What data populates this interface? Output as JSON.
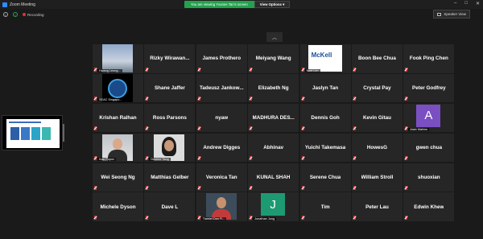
{
  "window": {
    "title": "Zoom Meeting",
    "controls": [
      "–",
      "□",
      "✕"
    ]
  },
  "banner": {
    "text": "You are viewing Yvonne Tan's screen",
    "view_options": "View Options ▾"
  },
  "infobar": {
    "recording": "Recording",
    "speaker_view": "Speaker View"
  },
  "colors": {
    "mute": "#e03b3b",
    "banner_green": "#23a24d",
    "tile_bg": "#262626"
  },
  "tiles": [
    {
      "name": "",
      "label": "Hwang Leong...",
      "video": "sky"
    },
    {
      "name": "Rizky  Wirawan...",
      "label": ""
    },
    {
      "name": "James Prothero",
      "label": ""
    },
    {
      "name": "Meiyang Wang",
      "label": ""
    },
    {
      "name": "",
      "label": "Noel Lim",
      "video": "mckell"
    },
    {
      "name": "Boon Bee Chua",
      "label": ""
    },
    {
      "name": "Fook Ping Chen",
      "label": ""
    },
    {
      "name": "",
      "label": "SEAC Singapo...",
      "video": "bee"
    },
    {
      "name": "Shane Jaffer",
      "label": ""
    },
    {
      "name": "Tadeusz  Jankow...",
      "label": ""
    },
    {
      "name": "Elizabeth Ng",
      "label": ""
    },
    {
      "name": "Jaslyn Tan",
      "label": ""
    },
    {
      "name": "Crystal Pay",
      "label": ""
    },
    {
      "name": "Peter Godfrey",
      "label": ""
    },
    {
      "name": "Krishan Ralhan",
      "label": ""
    },
    {
      "name": "Ross Parsons",
      "label": ""
    },
    {
      "name": "nyaw",
      "label": ""
    },
    {
      "name": "MADHURA  DES...",
      "label": ""
    },
    {
      "name": "Dennis Goh",
      "label": ""
    },
    {
      "name": "Kevin Gitau",
      "label": ""
    },
    {
      "name": "",
      "label": "Alain Mahieu",
      "avatar": "A",
      "avatar_color": "purple"
    },
    {
      "name": "",
      "label": "Ivan Popov",
      "video": "person1"
    },
    {
      "name": "",
      "label": "Desiree Tang",
      "video": "person2"
    },
    {
      "name": "Andrew Digges",
      "label": ""
    },
    {
      "name": "Abhinav",
      "label": ""
    },
    {
      "name": "Yuichi Takemasa",
      "label": ""
    },
    {
      "name": "HowesG",
      "label": ""
    },
    {
      "name": "gwen chua",
      "label": ""
    },
    {
      "name": "Wei Seong Ng",
      "label": ""
    },
    {
      "name": "Matthias Gelber",
      "label": ""
    },
    {
      "name": "Veronica Tan",
      "label": ""
    },
    {
      "name": "KUNAL SHAH",
      "label": ""
    },
    {
      "name": "Serene Chua",
      "label": ""
    },
    {
      "name": "William Stroll",
      "label": ""
    },
    {
      "name": "shuoxian",
      "label": ""
    },
    {
      "name": "Michele Dyson",
      "label": ""
    },
    {
      "name": "Dave L",
      "label": ""
    },
    {
      "name": "",
      "label": "Tiamiel Dan Fi...",
      "video": "person3"
    },
    {
      "name": "",
      "label": "Jonathan Jong",
      "avatar": "J",
      "avatar_color": "teal"
    },
    {
      "name": "Tim",
      "label": ""
    },
    {
      "name": "Peter Lau",
      "label": ""
    },
    {
      "name": "Edwin Khew",
      "label": ""
    }
  ]
}
